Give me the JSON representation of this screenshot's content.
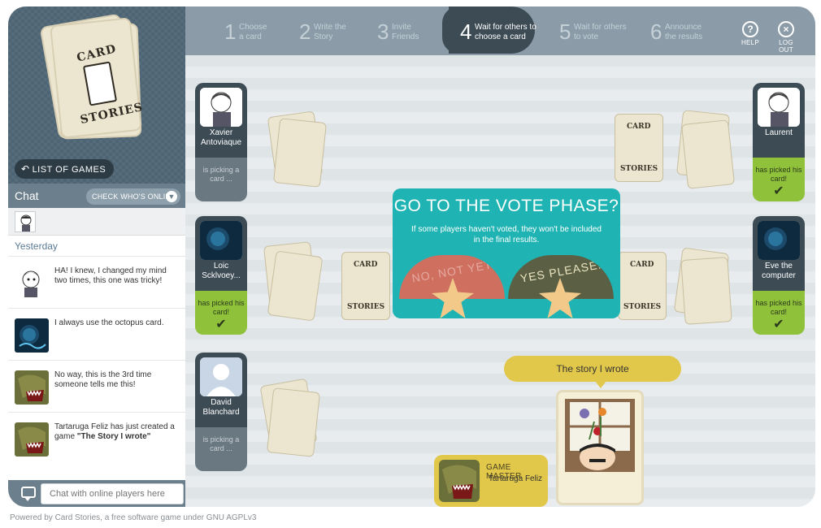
{
  "logo": {
    "word_top": "CARD",
    "word_bottom": "STORIES"
  },
  "sidebar": {
    "list_games_label": "LIST OF GAMES",
    "chat_title": "Chat",
    "check_online_label": "CHECK WHO'S ONLINE",
    "day_label": "Yesterday",
    "messages": [
      {
        "avatar": "cartoon-boy-avatar",
        "text": "HA! I knew, I changed my mind two times, this one was tricky!"
      },
      {
        "avatar": "octopus-avatar",
        "text": "I always use the octopus card."
      },
      {
        "avatar": "dinosaur-avatar",
        "text": "No way, this is the 3rd time someone tells me this!"
      },
      {
        "avatar": "dinosaur-avatar",
        "text_prefix": "Tartaruga Feliz has just created a game ",
        "text_bold": "\"The Story I wrote\""
      }
    ],
    "chat_placeholder": "Chat with online players here"
  },
  "steps": [
    {
      "num": "1",
      "label": "Choose a card"
    },
    {
      "num": "2",
      "label": "Write the Story"
    },
    {
      "num": "3",
      "label": "Invite Friends"
    },
    {
      "num": "4",
      "label": "Wait for others to choose a card",
      "active": true
    },
    {
      "num": "5",
      "label": "Wait for others to vote"
    },
    {
      "num": "6",
      "label": "Announce the results"
    }
  ],
  "top_buttons": {
    "help": "HELP",
    "logout": "LOG OUT"
  },
  "players": [
    {
      "name": "Xavier Antoviaque",
      "status": "is picking a card ...",
      "picked": false
    },
    {
      "name": "Loic Scklvoey...",
      "status": "has picked his card!",
      "picked": true
    },
    {
      "name": "David Blanchard",
      "status": "is picking a card ...",
      "picked": false
    },
    {
      "name": "Laurent",
      "status": "has picked his card!",
      "picked": true
    },
    {
      "name": "Eve the computer",
      "status": "has picked his card!",
      "picked": true
    }
  ],
  "check_glyph": "✔",
  "vote_modal": {
    "title": "GO TO THE VOTE PHASE?",
    "description": "If some players haven't voted, they won't be included in the final results.",
    "no_label": "NO, NOT YET",
    "yes_label": "YES PLEASE!"
  },
  "story": {
    "title": "The story I wrote"
  },
  "game_master": {
    "label": "GAME MASTER",
    "name": "Tartaruga Feliz"
  },
  "footer": "Powered by Card Stories, a free software game under GNU AGPLv3",
  "colors": {
    "panel_dark": "#3d4b55",
    "picked_green": "#8fc13b",
    "modal_teal": "#1fb4b3",
    "story_yellow": "#e2c84a"
  }
}
